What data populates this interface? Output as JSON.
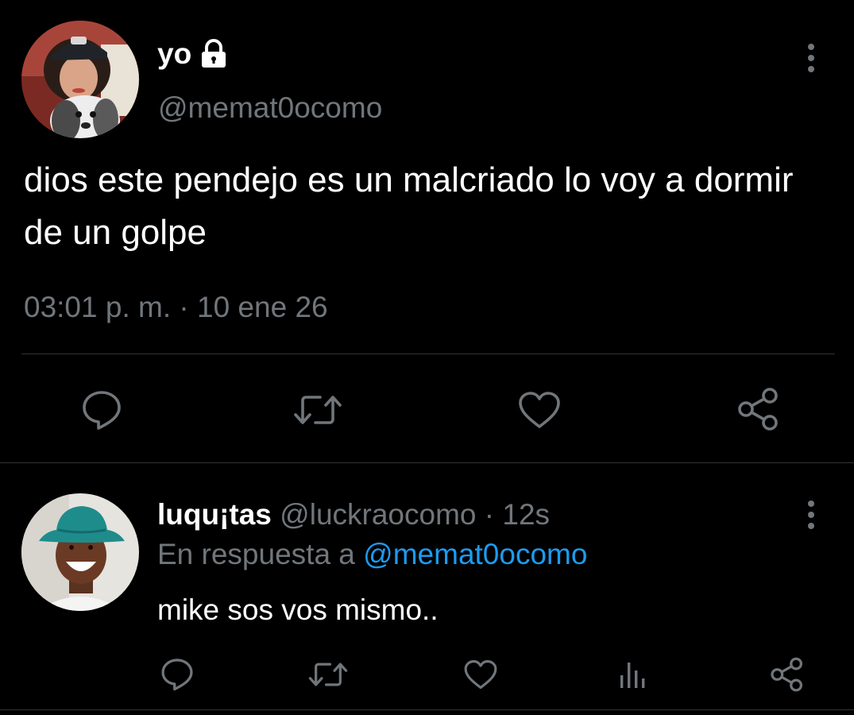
{
  "main_tweet": {
    "display_name": "yo",
    "handle": "@memat0ocomo",
    "text": "dios este pendejo es un malcriado lo voy a dormir de un golpe",
    "time": "03:01 p. m.",
    "separator": "·",
    "date": "10 ene 26",
    "icons": {
      "lock": "lock-icon",
      "menu": "more-vertical-icon",
      "reply": "reply-icon",
      "retweet": "retweet-icon",
      "like": "heart-icon",
      "share": "share-icon"
    }
  },
  "reply_tweet": {
    "display_name": "luqu¡tas",
    "handle": "@luckraocomo",
    "separator": "·",
    "time": "12s",
    "reply_prefix": "En respuesta a",
    "reply_to": "@memat0ocomo",
    "text": "mike sos vos mismo..",
    "icons": {
      "menu": "more-vertical-icon",
      "reply": "reply-icon",
      "retweet": "retweet-icon",
      "like": "heart-icon",
      "analytics": "analytics-icon",
      "share": "share-icon"
    }
  },
  "colors": {
    "background": "#000000",
    "text_primary": "#ffffff",
    "text_secondary": "#71767b",
    "link": "#1d9bf0",
    "divider": "#2f3336"
  }
}
